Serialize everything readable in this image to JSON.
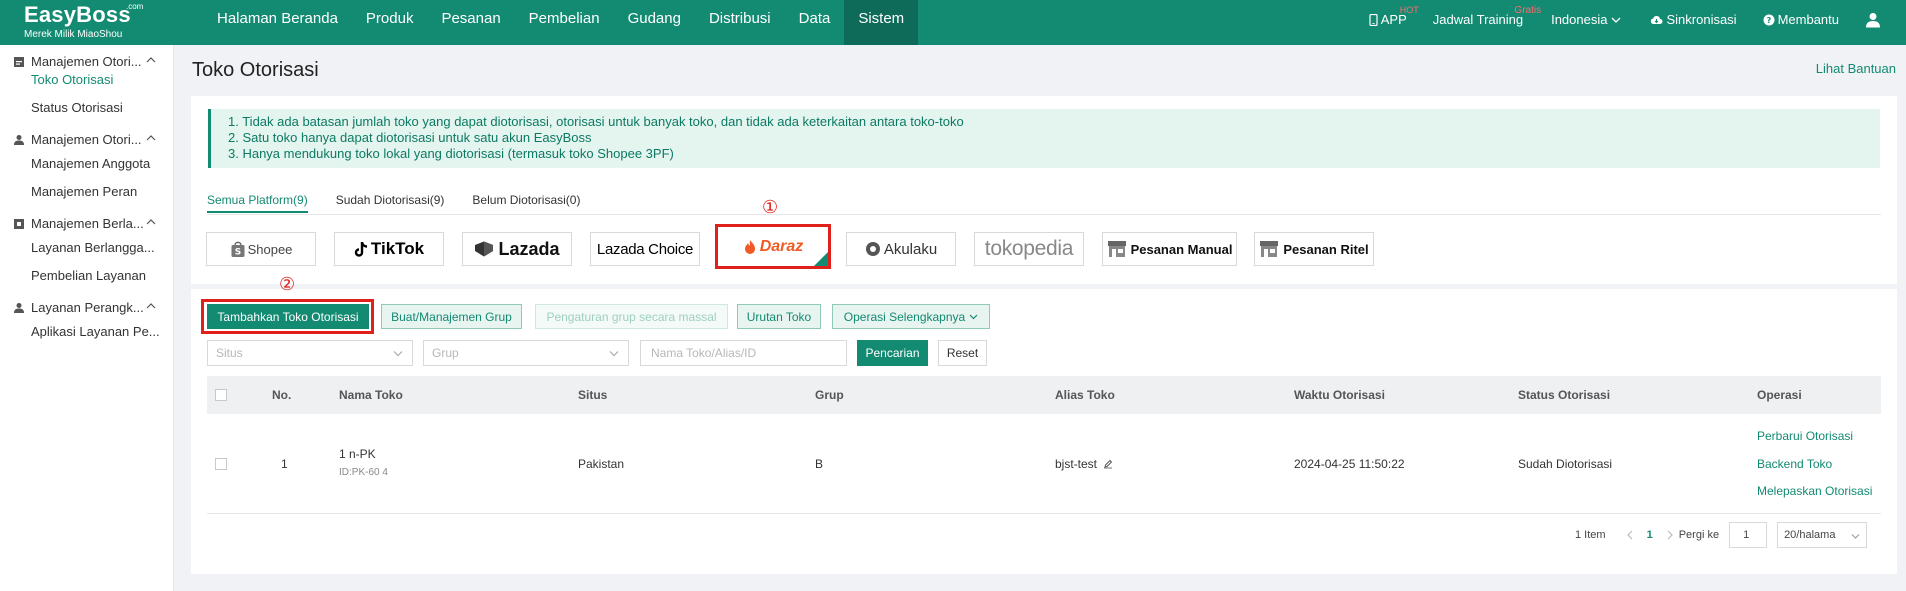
{
  "brand": {
    "name": "EasyBoss",
    "com": ".com",
    "subtitle": "Merek Milik MiaoShou"
  },
  "nav": [
    "Halaman Beranda",
    "Produk",
    "Pesanan",
    "Pembelian",
    "Gudang",
    "Distribusi",
    "Data",
    "Sistem"
  ],
  "nav_active": "Sistem",
  "topbar_right": {
    "app": "APP",
    "app_badge": "HOT",
    "training": "Jadwal Training",
    "training_badge": "Gratis",
    "language": "Indonesia",
    "sync": "Sinkronisasi",
    "help": "Membantu"
  },
  "sidebar": {
    "groups": [
      {
        "label": "Manajemen Otori...",
        "icon": "store-icon",
        "items": [
          "Toko Otorisasi",
          "Status Otorisasi"
        ]
      },
      {
        "label": "Manajemen Otori...",
        "icon": "person-icon",
        "items": [
          "Manajemen Anggota",
          "Manajemen Peran"
        ]
      },
      {
        "label": "Manajemen Berla...",
        "icon": "subscription-icon",
        "items": [
          "Layanan Berlangga...",
          "Pembelian Layanan"
        ]
      },
      {
        "label": "Layanan Perangk...",
        "icon": "person-icon",
        "items": [
          "Aplikasi Layanan Pe..."
        ]
      }
    ],
    "active_item": "Toko Otorisasi"
  },
  "page": {
    "title": "Toko Otorisasi",
    "help_link": "Lihat Bantuan",
    "notices": [
      "1. Tidak ada batasan jumlah toko yang dapat diotorisasi, otorisasi untuk banyak toko, dan tidak ada keterkaitan antara toko-toko",
      "2. Satu toko hanya dapat diotorisasi untuk satu akun EasyBoss",
      "3. Hanya mendukung toko lokal yang diotorisasi (termasuk toko Shopee 3PF)"
    ],
    "tabs": [
      "Semua Platform(9)",
      "Sudah Diotorisasi(9)",
      "Belum Diotorisasi(0)"
    ],
    "active_tab": "Semua Platform(9)",
    "platforms": [
      "Shopee",
      "TikTok",
      "Lazada",
      "Lazada Choice",
      "Daraz",
      "Akulaku",
      "tokopedia",
      "Pesanan Manual",
      "Pesanan Ritel"
    ],
    "selected_platform": "Daraz",
    "annotations": [
      "①",
      "②"
    ]
  },
  "toolbar": {
    "add": "Tambahkan Toko Otorisasi",
    "group": "Buat/Manajemen Grup",
    "bulk_group": "Pengaturan grup secara massal",
    "order": "Urutan Toko",
    "more": "Operasi Selengkapnya"
  },
  "filters": {
    "site_placeholder": "Situs",
    "group_placeholder": "Grup",
    "search_placeholder": "Nama Toko/Alias/ID",
    "search_button": "Pencarian",
    "reset_button": "Reset"
  },
  "table": {
    "columns": [
      "No.",
      "Nama Toko",
      "Situs",
      "Grup",
      "Alias Toko",
      "Waktu Otorisasi",
      "Status Otorisasi",
      "Operasi"
    ],
    "rows": [
      {
        "no": "1",
        "shop_name": "1              n-PK",
        "shop_id": "ID:PK-60              4",
        "site": "Pakistan",
        "group": "B",
        "alias": "bjst-test",
        "auth_time": "2024-04-25 11:50:22",
        "status": "Sudah Diotorisasi",
        "ops": [
          "Perbarui Otorisasi",
          "Backend Toko",
          "Melepaskan Otorisasi"
        ]
      }
    ]
  },
  "pagination": {
    "total": "1 Item",
    "current": "1",
    "goto_label": "Pergi ke",
    "goto_value": "1",
    "page_size": "20/halama"
  },
  "colors": {
    "primary": "#138a72",
    "highlight": "#e0201b",
    "daraz": "#f15a24"
  }
}
